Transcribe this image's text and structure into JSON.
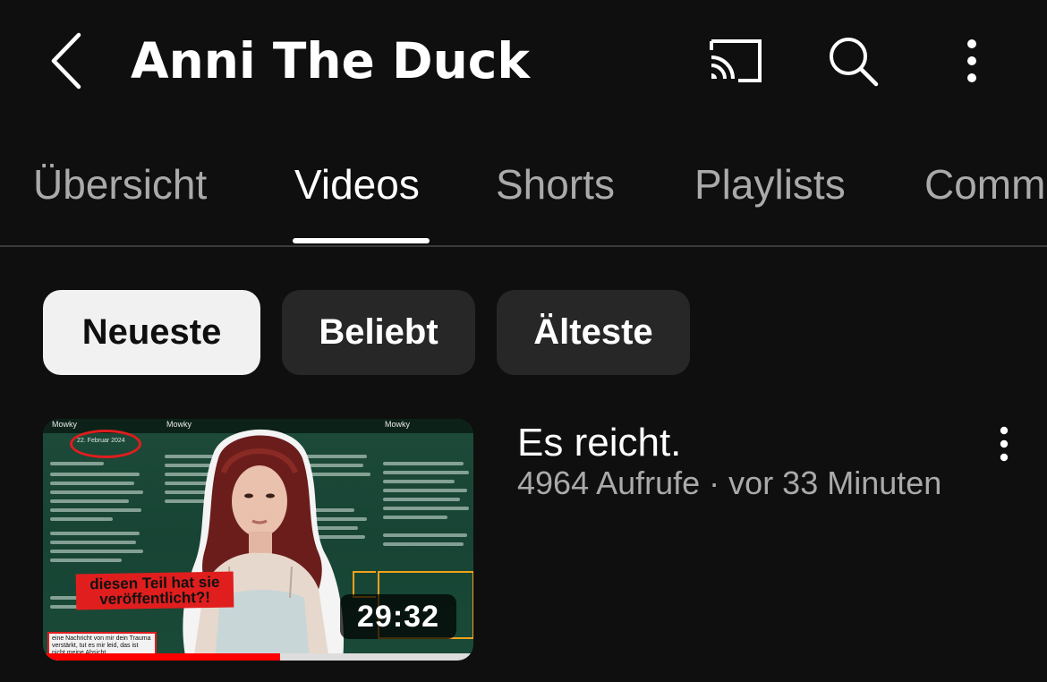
{
  "header": {
    "title": "Anni The Duck",
    "back_icon": "back-arrow-icon",
    "cast_icon": "cast-icon",
    "search_icon": "search-icon",
    "more_icon": "more-vertical-icon"
  },
  "tabs": [
    {
      "label": "Übersicht",
      "active": false
    },
    {
      "label": "Videos",
      "active": true
    },
    {
      "label": "Shorts",
      "active": false
    },
    {
      "label": "Playlists",
      "active": false
    },
    {
      "label": "Comm",
      "active": false
    }
  ],
  "chips": [
    {
      "label": "Neueste",
      "selected": true
    },
    {
      "label": "Beliebt",
      "selected": false
    },
    {
      "label": "Älteste",
      "selected": false
    }
  ],
  "videos": [
    {
      "title": "Es reicht.",
      "views": "4964 Aufrufe",
      "separator": " · ",
      "age": "vor 33 Minuten",
      "duration": "29:32",
      "watch_progress": 0.55,
      "thumbnail": {
        "panel_name": "Mowky",
        "date_label": "22. Februar 2024",
        "caption": "diesen Teil hat sie veröffentlicht?!",
        "small_caption": "eine Nachricht von mir dein Trauma verstärkt, tut es mir leid, das ist nicht meine Absicht."
      }
    }
  ],
  "colors": {
    "background": "#0f0f0f",
    "chip_bg": "#272727",
    "chip_selected_bg": "#f1f1f1",
    "secondary_text": "#aaaaaa",
    "progress": "#ff0000"
  }
}
